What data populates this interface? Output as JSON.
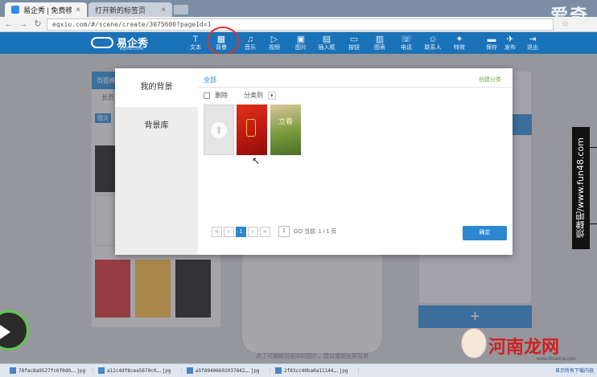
{
  "browser": {
    "tabs": [
      {
        "title": "易企秀 | 免费移动场景应用…",
        "close": "×"
      },
      {
        "title": "打开新的标签页",
        "close": "×"
      }
    ],
    "watermark_top": "爱奇",
    "url": "eqxiu.com/#/scene/create/3075600?pageId=1"
  },
  "app": {
    "logo_text": "易企秀",
    "logo_sub": "EQXIU.COM",
    "toolbar": [
      {
        "label": "文本",
        "icon": "T"
      },
      {
        "label": "背景",
        "icon": "▦"
      },
      {
        "label": "音乐",
        "icon": "♫"
      },
      {
        "label": "视频",
        "icon": "▷"
      },
      {
        "label": "图片",
        "icon": "▣"
      },
      {
        "label": "插入框",
        "icon": "▤"
      },
      {
        "label": "按钮",
        "icon": "▭"
      },
      {
        "label": "图表",
        "icon": "▥"
      },
      {
        "label": "电话",
        "icon": "☏"
      },
      {
        "label": "联系人",
        "icon": "☺"
      },
      {
        "label": "特效",
        "icon": "✦"
      },
      {
        "label": "保存",
        "icon": "▬"
      },
      {
        "label": "发布",
        "icon": "✈"
      },
      {
        "label": "退出",
        "icon": "⇥"
      }
    ],
    "left_panel_header": "页面模版",
    "left_panel_tabs": "长页",
    "left_panel_chip": "图文",
    "phone_caption": "点了可编辑页面中的图片，建议使用全屏背景"
  },
  "modal": {
    "sidebar": [
      "我的背景",
      "背景库"
    ],
    "filter_all": "全部",
    "create_category": "创建分类",
    "delete_label": "删除",
    "move_to_label": "分类到",
    "upload_arrow": "⬆",
    "bg2_text": "立春",
    "pager": {
      "first": "«",
      "prev": "‹",
      "current": "1",
      "next": "›",
      "last": "»",
      "input": "1",
      "go_text": "GO 当前: 1 / 1 页"
    },
    "confirm_label": "确定"
  },
  "right_add": "+",
  "vertical_watermark": "烦肆吧/www.fun48.com",
  "downloads": [
    "78fac8a9527fc6f0d0….jpg",
    "a12c4df8cea5670c0….jpg",
    "a5f89406602037842….jpg",
    "2f83cc40ba0a11144….jpg"
  ],
  "download_show_all": "显示所有下载内容",
  "site_watermark": {
    "title": "河南龙网",
    "sub": "www.3manna.com"
  }
}
